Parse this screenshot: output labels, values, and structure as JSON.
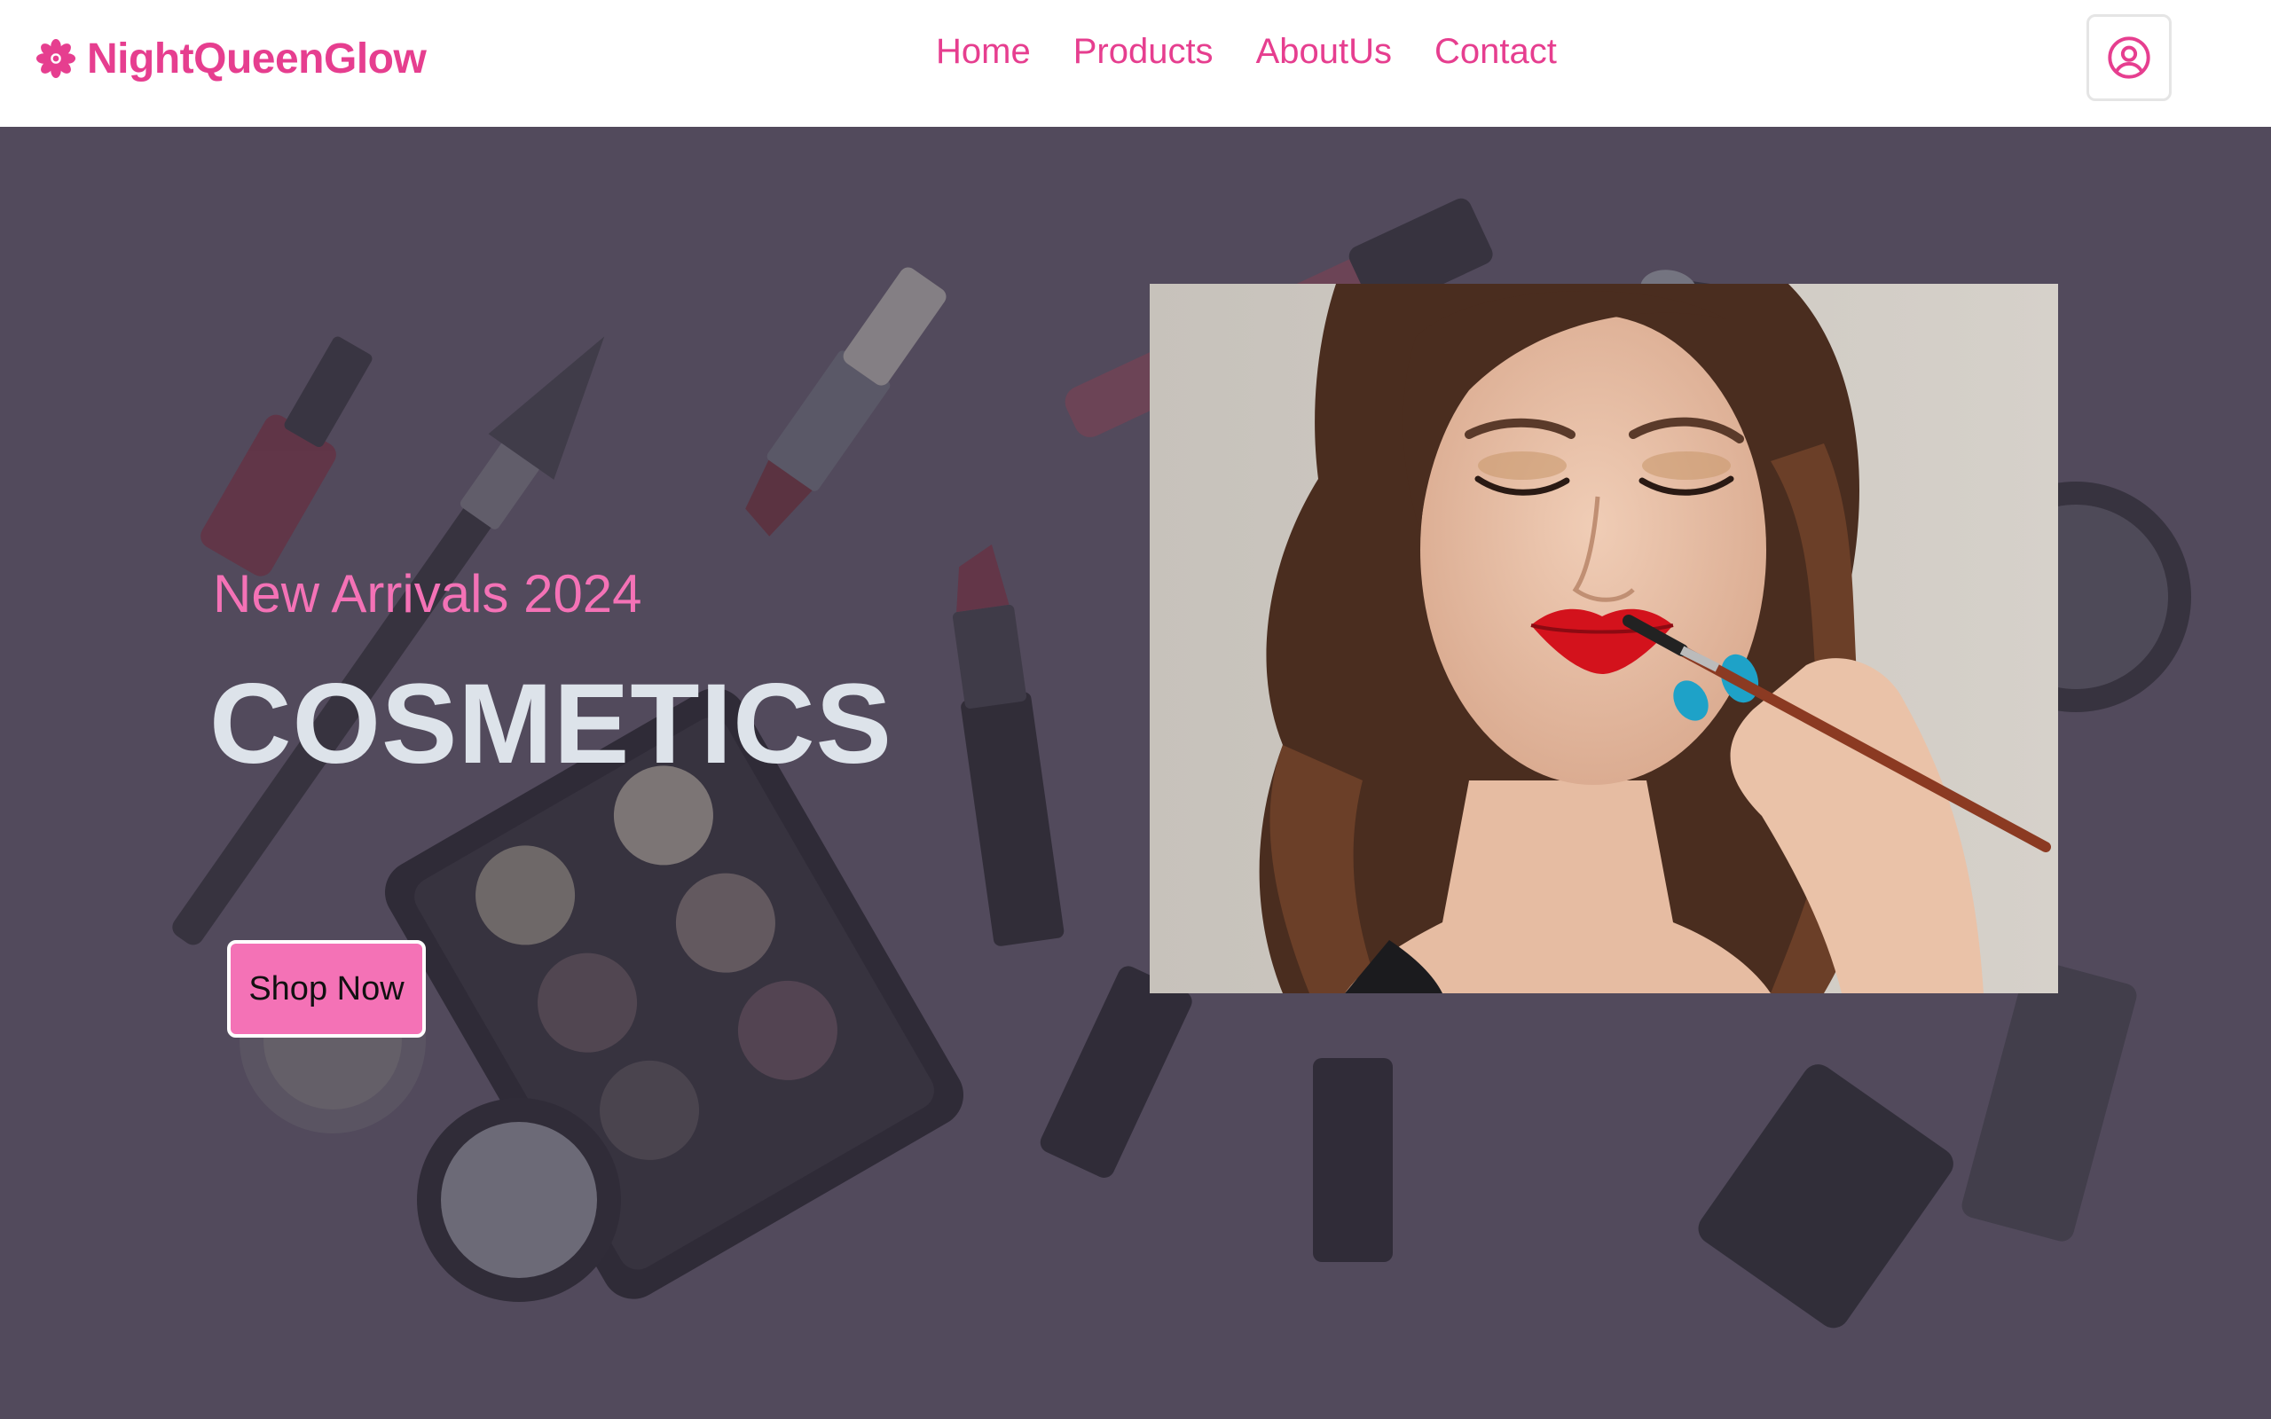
{
  "brand": {
    "name": "NightQueenGlow",
    "icon": "flower-icon",
    "color": "#e63e8f"
  },
  "nav": {
    "items": [
      {
        "label": "Home"
      },
      {
        "label": "Products"
      },
      {
        "label": "AboutUs"
      },
      {
        "label": "Contact"
      }
    ]
  },
  "header": {
    "user_icon": "user-circle-icon"
  },
  "hero": {
    "subtitle": "New Arrivals 2024",
    "headline": "COSMETICS",
    "cta_label": "Shop Now",
    "background_image": "cosmetics-flatlay",
    "feature_image": "model-applying-red-lipstick",
    "accent_color": "#f472b6"
  }
}
